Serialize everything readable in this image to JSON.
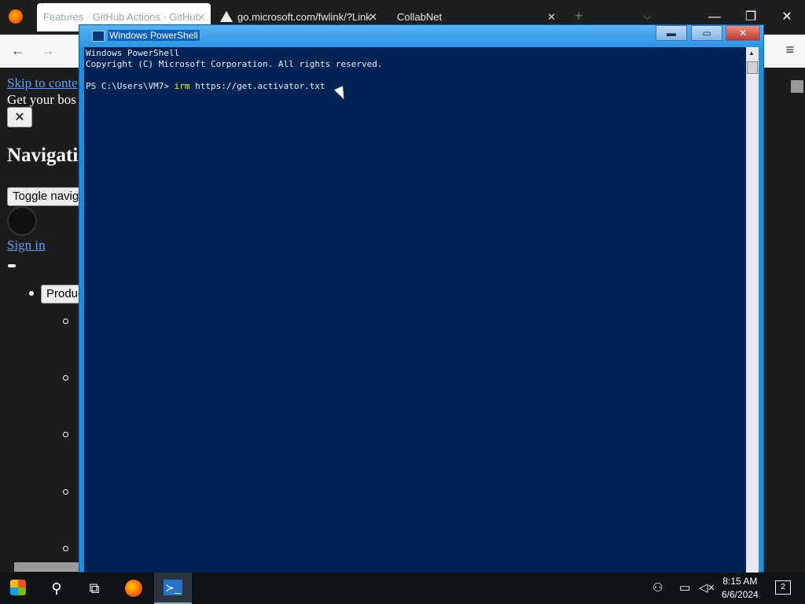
{
  "browser": {
    "tabs": [
      {
        "label": "Features · GitHub Actions · GitHub",
        "active": true
      },
      {
        "label": "go.microsoft.com/fwlink/?Link",
        "active": false
      },
      {
        "label": "CollabNet",
        "active": false
      }
    ],
    "new_tab": "+",
    "window_controls": {
      "minimize": "—",
      "restore": "❐",
      "close": "✕"
    },
    "nav": {
      "back": "←",
      "forward": "→",
      "menu": "≡"
    }
  },
  "page": {
    "skip_link": "Skip to conte",
    "banner_text": "Get your bos",
    "close_label": "✕",
    "heading": "Navigati",
    "toggle_button": "Toggle naviga",
    "sign_in": "Sign in",
    "products_button": "Produc"
  },
  "powershell": {
    "title": "Windows PowerShell",
    "header_line1": "Windows PowerShell",
    "header_line2": "Copyright (C) Microsoft Corporation. All rights reserved.",
    "prompt": "PS C:\\Users\\VM7> ",
    "command_keyword": "irm",
    "command_arg": " https://get.activator.txt",
    "buttons": {
      "minimize": "▬",
      "maximize": "▭",
      "close": "✕"
    }
  },
  "taskbar": {
    "time": "8:15 AM",
    "date": "6/6/2024",
    "notification_count": "2",
    "icons": [
      "start-icon",
      "search-icon",
      "task-view-icon",
      "firefox-icon",
      "powershell-icon"
    ],
    "tray_icons": [
      "people-icon",
      "network-icon",
      "volume-muted-icon"
    ]
  }
}
